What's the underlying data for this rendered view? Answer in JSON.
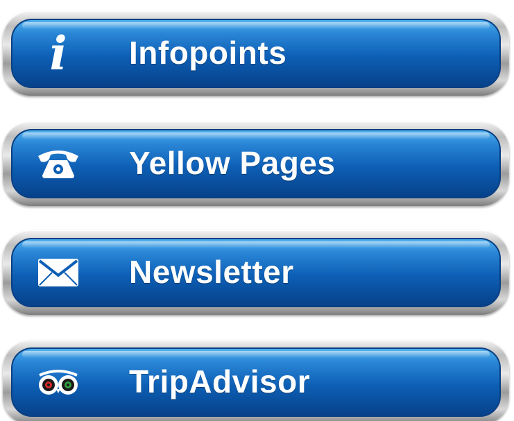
{
  "menu": {
    "buttons": [
      {
        "label": "Infopoints",
        "icon": "info-icon"
      },
      {
        "label": "Yellow Pages",
        "icon": "telephone-icon"
      },
      {
        "label": "Newsletter",
        "icon": "envelope-icon"
      },
      {
        "label": "TripAdvisor",
        "icon": "tripadvisor-owl-icon"
      }
    ],
    "info_glyph": "i"
  },
  "colors": {
    "button_face_top": "#4fb0ee",
    "button_face_bottom": "#07418a",
    "button_frame": "#bdbdbd",
    "label_text": "#ffffff"
  }
}
